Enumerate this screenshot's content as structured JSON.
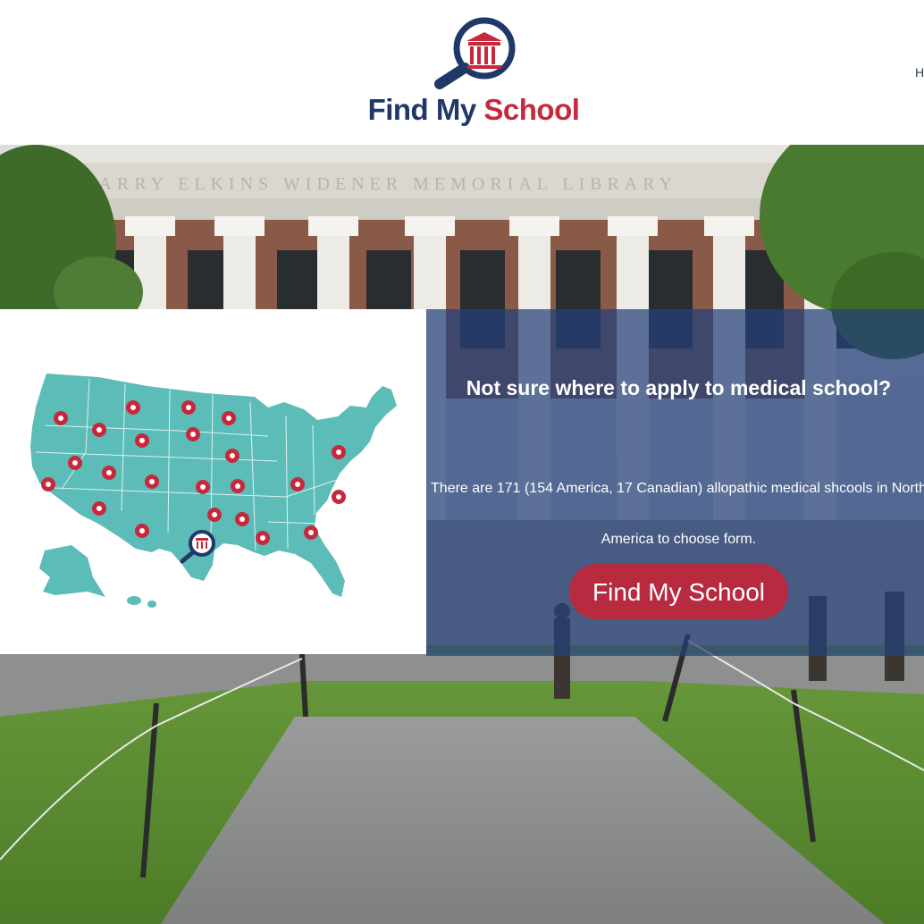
{
  "header": {
    "logo_find": "Find My",
    "logo_school": "School",
    "nav_first_letter": "H"
  },
  "hero": {
    "building_inscription": "HARRY ELKINS WIDENER MEMORIAL LIBRARY"
  },
  "panel": {
    "title": "Not sure where to apply to medical school?",
    "body": "There are 171 (154 America, 17 Canadian) allopathic medical shcools in North America to choose form.",
    "button_label": "Find My School"
  },
  "colors": {
    "navy": "#1f3868",
    "red": "#c8283c",
    "teal": "#5bbcb8",
    "panel": "#24407a",
    "button": "#b72a40"
  },
  "icons": [
    "magnifier-logo-icon",
    "courthouse-icon",
    "map-pin-icon"
  ]
}
